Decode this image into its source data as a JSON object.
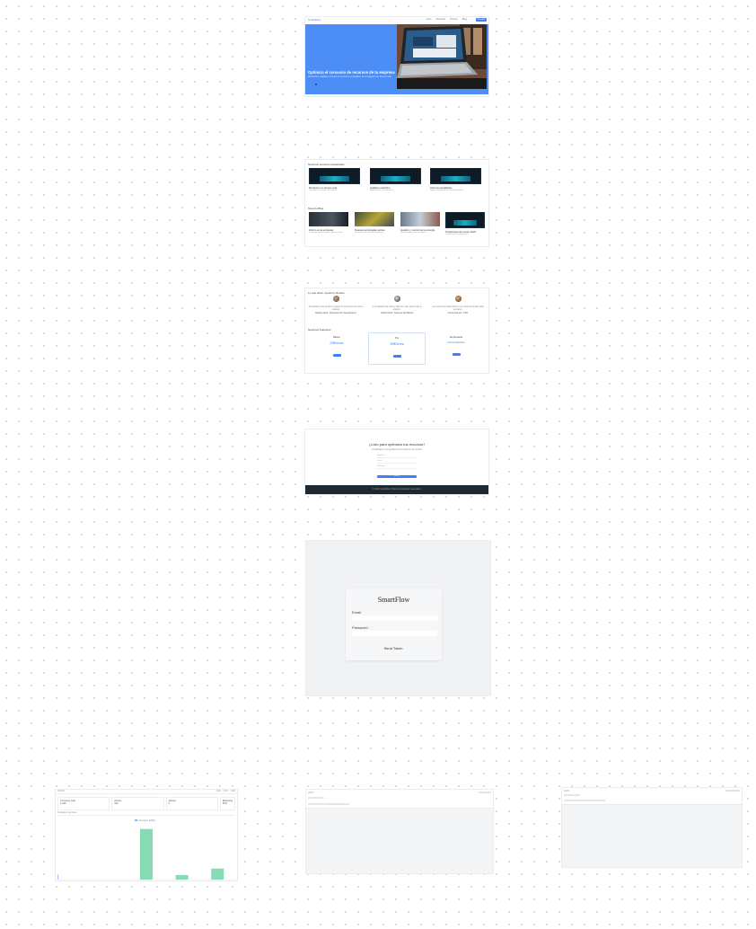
{
  "landing": {
    "logo": "SmartFlow",
    "nav": [
      "Inicio",
      "Servicios",
      "Precios",
      "Blog"
    ],
    "nav_cta": "Acceder",
    "hero_title": "Optimiza el consumo de recursos de tu empresa",
    "hero_subtitle": "Monitoriza, analiza y reduce el consumo energético de tu negocio en tiempo real",
    "featured_heading": "Nuestros servicios destacados",
    "featured": [
      {
        "title": "Monitoreo en tiempo real",
        "desc": "Visualiza el consumo al instante"
      },
      {
        "title": "Análisis predictivo",
        "desc": "Anticipa picos y tendencias"
      },
      {
        "title": "Informes detallados",
        "desc": "Reportes automáticos personalizados"
      }
    ],
    "blog_heading": "Nuestro Blog",
    "blog": [
      {
        "title": "Ahorro en la empresa",
        "desc": "Consejos prácticos para reducir costes"
      },
      {
        "title": "Nuevas tecnologías verdes",
        "desc": "Innovación al servicio del planeta"
      },
      {
        "title": "Gestión y control de la energía",
        "desc": "Herramientas para tu negocio"
      },
      {
        "title": "Tendencias del sector 2024",
        "desc": "Lo que viene en eficiencia"
      }
    ],
    "testimonials_heading": "Lo que dicen nuestros clientes",
    "testimonials": [
      {
        "quote": "SmartFlow nos ayudó a reducir el consumo de forma notable.",
        "author": "María López, Directora de Operaciones"
      },
      {
        "quote": "Una plataforma clara y fácil de usar para todo el equipo.",
        "author": "Carlos Ruiz, Gerente de Planta"
      },
      {
        "quote": "Los informes automáticos nos ahorran horas cada semana.",
        "author": "Laura Gómez, CFO"
      }
    ],
    "pricing_heading": "Nuestros Paquetes",
    "plans": [
      {
        "name": "Básico",
        "price": "29€/mes",
        "cta": "Elegir"
      },
      {
        "name": "Pro",
        "price": "59€/mes",
        "cta": "Elegir"
      },
      {
        "name": "Empresarial",
        "price": "Personalizado",
        "cta": "Contactar"
      }
    ],
    "contact_title": "¿Listo para optimizar tus recursos?",
    "contact_subtitle": "Contáctanos y te ayudaremos a empezar hoy mismo",
    "contact_fields": [
      "Nombre",
      "Email",
      "Mensaje"
    ],
    "contact_button": "Enviar",
    "footer": "© 2024 SmartFlow. Todos los derechos reservados."
  },
  "login": {
    "brand": "SmartFlow",
    "email_label": "Email",
    "password_label": "Password",
    "submit": "Send Token"
  },
  "dashboard": {
    "kpis": [
      {
        "label": "Consumo total",
        "value": "1.240"
      },
      {
        "label": "Ahorro",
        "value": "320"
      },
      {
        "label": "Alertas",
        "value": "3"
      },
      {
        "label": "Eficiencia",
        "value": "87%"
      }
    ],
    "chart_title": "Consumo por área",
    "legend": "Consumo (kWh)",
    "chart_data": {
      "type": "bar",
      "categories": [
        "A",
        "B",
        "C",
        "D",
        "E"
      ],
      "values": [
        8,
        0,
        78,
        7,
        17
      ],
      "colors": [
        "#8fb4f2",
        "#8fb4f2",
        "#86dab4",
        "#86dab4",
        "#86dab4"
      ],
      "ylim": [
        0,
        90
      ]
    }
  },
  "colors": {
    "accent": "#3b82f6",
    "hero": "#4c8ef5",
    "footer": "#1f2933"
  }
}
